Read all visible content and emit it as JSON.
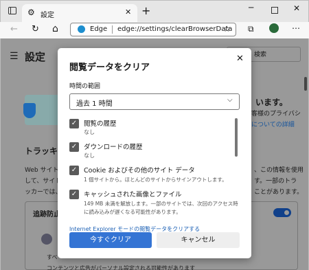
{
  "browser": {
    "tab_title": "設定",
    "new_tab": "+",
    "address_brand": "Edge",
    "address_url": "edge://settings/clearBrowserData"
  },
  "settings": {
    "title": "設定",
    "search": "検索",
    "headline": "います。",
    "line1": "客様のプライバシ",
    "line2": "についての詳細",
    "tracking": "トラッキン",
    "p1": "Web サイトで",
    "p1r": "、この情報を使用",
    "p2": "して、サイトの",
    "p2r": "す。一部のトラ",
    "p3": "ッカーでは、ユ",
    "p3r": "ことがあります。",
    "card_title": "追跡防止",
    "bullet1": "すべ",
    "bullet2": "コンテンツと広告がパーソナル設定される可能性があります"
  },
  "dialog": {
    "title": "閲覧データをクリア",
    "range_label": "時間の範囲",
    "range_value": "過去 1 時間",
    "items": [
      {
        "label": "閲覧の履歴",
        "desc": "なし"
      },
      {
        "label": "ダウンロードの履歴",
        "desc": "なし"
      },
      {
        "label": "Cookie およびその他のサイト データ",
        "desc": "1 個サイトから。ほとんどのサイトからサインアウトします。"
      },
      {
        "label": "キャッシュされた画像とファイル",
        "desc": "149 MB 未満を解放します。一部のサイトでは、次回のアクセス時",
        "desc2": "に読み込みが遅くなる可能性があります。"
      }
    ],
    "ie_link": "Internet Explorer モードの閲覧データをクリアする",
    "clear_button": "今すぐクリア",
    "cancel_button": "キャンセル"
  },
  "colors": {
    "accent": "#1a73e8",
    "clear_bg": "#3474d4"
  }
}
